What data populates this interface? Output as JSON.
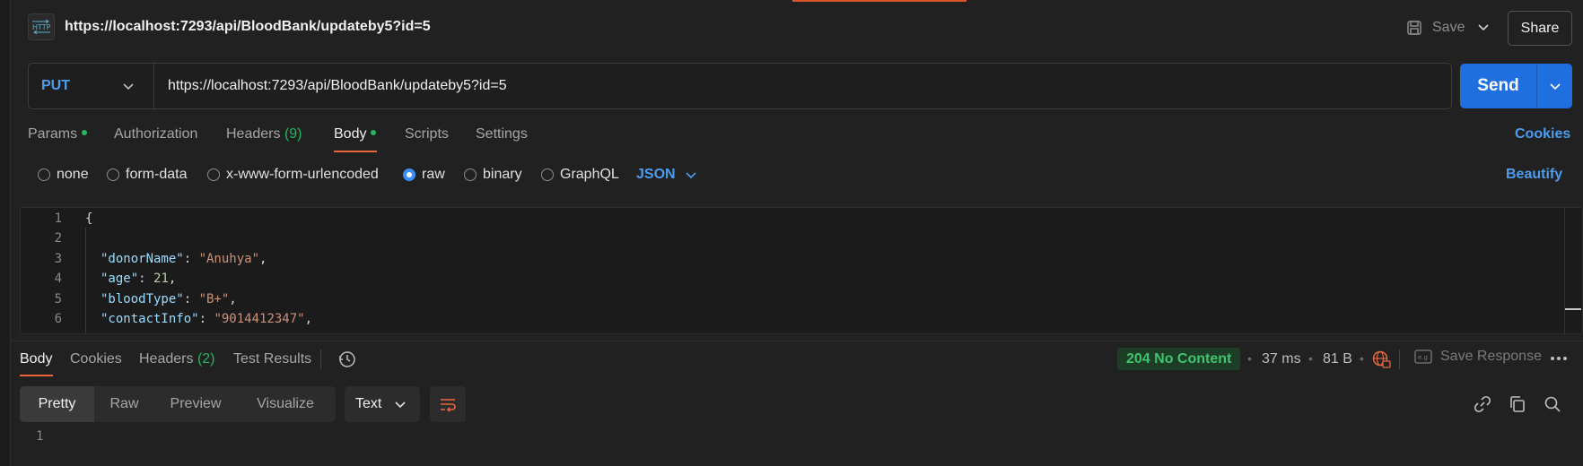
{
  "tab": {
    "title": "https://localhost:7293/api/BloodBank/updateby5?id=5",
    "icon": "http-icon"
  },
  "header": {
    "save_label": "Save",
    "share_label": "Share"
  },
  "request": {
    "method": "PUT",
    "url": "https://localhost:7293/api/BloodBank/updateby5?id=5",
    "send_label": "Send"
  },
  "req_tabs": {
    "params": "Params",
    "authorization": "Authorization",
    "headers": "Headers",
    "headers_count": "(9)",
    "body": "Body",
    "scripts": "Scripts",
    "settings": "Settings",
    "cookies": "Cookies",
    "active": "Body"
  },
  "body_types": {
    "options": [
      "none",
      "form-data",
      "x-www-form-urlencoded",
      "raw",
      "binary",
      "GraphQL"
    ],
    "selected": "raw",
    "format": "JSON",
    "beautify": "Beautify"
  },
  "editor": {
    "line_numbers": [
      "1",
      "2",
      "3",
      "4",
      "5",
      "6"
    ],
    "open_brace": "{",
    "lines": [
      {
        "key": "\"donorName\"",
        "value": "\"Anuhya\"",
        "value_type": "string"
      },
      {
        "key": "\"age\"",
        "value": "21",
        "value_type": "number"
      },
      {
        "key": "\"bloodType\"",
        "value": "\"B+\"",
        "value_type": "string"
      },
      {
        "key": "\"contactInfo\"",
        "value": "\"9014412347\"",
        "value_type": "string"
      }
    ]
  },
  "response": {
    "tabs": {
      "body": "Body",
      "cookies": "Cookies",
      "headers": "Headers",
      "headers_count": "(2)",
      "test_results": "Test Results"
    },
    "status": "204 No Content",
    "time": "37 ms",
    "size": "81 B",
    "save_response": "Save Response",
    "views": [
      "Pretty",
      "Raw",
      "Preview",
      "Visualize"
    ],
    "active_view": "Pretty",
    "format": "Text",
    "line_numbers": [
      "1"
    ]
  },
  "colors": {
    "accent": "#e8663d",
    "send_blue": "#1f6fe0",
    "link_blue": "#4d9cf0",
    "status_green": "#3ec46d",
    "background": "#212121"
  }
}
